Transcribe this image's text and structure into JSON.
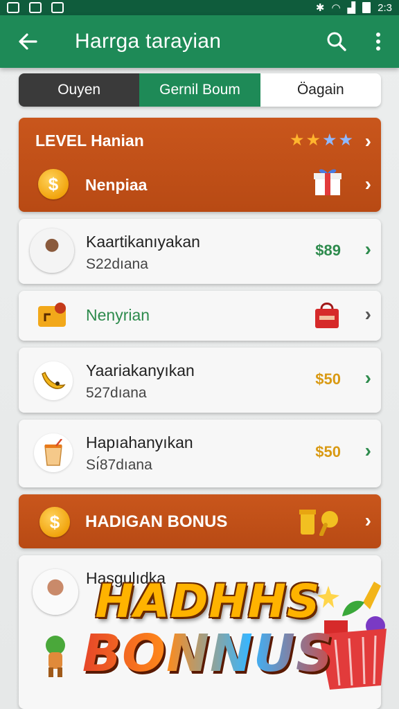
{
  "status_bar": {
    "time": "2:3"
  },
  "app_bar": {
    "title": "Harrga tarayian",
    "back_icon": "arrow-left-icon",
    "search_icon": "search-icon",
    "more_icon": "more-vert-icon"
  },
  "tabs": [
    {
      "label": "Ouyen"
    },
    {
      "label": "Gernil Boum"
    },
    {
      "label": "Öagain"
    }
  ],
  "level_card": {
    "title": "LEVEL Hanian",
    "stars": "★★★★",
    "reward_label": "Nenpiaa",
    "coin_symbol": "$"
  },
  "rows": [
    {
      "title": "Kaartikanıyakan",
      "subtitle": "S22dıana",
      "price": "$89"
    },
    {
      "title": "Nenyrian"
    },
    {
      "title": "Yaariakanyıkan",
      "subtitle": "527dıana",
      "price": "$50"
    },
    {
      "title": "Hapıahanyıkan",
      "subtitle": "Sı́87dıana",
      "price": "$50"
    }
  ],
  "bonus_card": {
    "title": "HADIGAN BONUS",
    "coin_symbol": "$"
  },
  "profile_row": {
    "title": "Hasgulıdka"
  },
  "banner": {
    "line1": "HADHHS",
    "line2": "BONNUS"
  },
  "colors": {
    "primary": "#1e8a57",
    "accent_orange": "#c9561c",
    "price_green": "#2e8b4d",
    "price_gold": "#d99a14"
  }
}
